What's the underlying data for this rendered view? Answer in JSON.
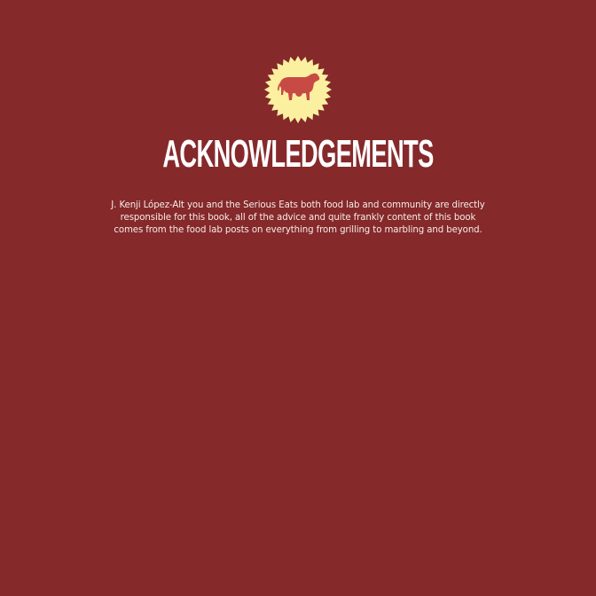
{
  "page": {
    "background_color": "#85292b",
    "title": "ACKNOWLEDGEMENTS",
    "badge": {
      "icon": "cow-icon",
      "burst_color": "#fbf0a0",
      "icon_color": "#c84a45"
    },
    "body_lines": [
      "J. Kenji López-Alt you and the Serious Eats both food lab and community are directly",
      "responsible for this book, all of the advice and quite frankly content of this book",
      "comes from the food lab posts on everything from grilling to marbling and beyond."
    ]
  }
}
